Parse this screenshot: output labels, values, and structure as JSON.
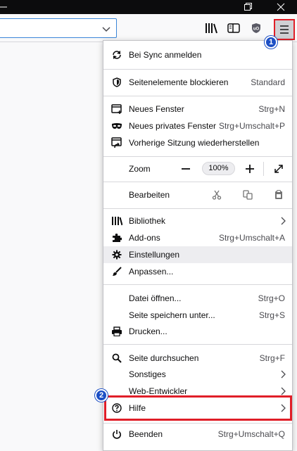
{
  "menu": {
    "sync": "Bei Sync anmelden",
    "blocking": {
      "label": "Seitenelemente blockieren",
      "value": "Standard"
    },
    "new_window": {
      "label": "Neues Fenster",
      "shortcut": "Strg+N"
    },
    "private_window": {
      "label": "Neues privates Fenster",
      "shortcut": "Strg+Umschalt+P"
    },
    "restore_session": "Vorherige Sitzung wiederherstellen",
    "zoom": {
      "label": "Zoom",
      "level": "100%"
    },
    "edit": "Bearbeiten",
    "library": "Bibliothek",
    "addons": {
      "label": "Add-ons",
      "shortcut": "Strg+Umschalt+A"
    },
    "settings": "Einstellungen",
    "customize": "Anpassen...",
    "open_file": {
      "label": "Datei öffnen...",
      "shortcut": "Strg+O"
    },
    "save_page": {
      "label": "Seite speichern unter...",
      "shortcut": "Strg+S"
    },
    "print": "Drucken...",
    "find": {
      "label": "Seite durchsuchen",
      "shortcut": "Strg+F"
    },
    "more": "Sonstiges",
    "web_dev": "Web-Entwickler",
    "help": "Hilfe",
    "quit": {
      "label": "Beenden",
      "shortcut": "Strg+Umschalt+Q"
    }
  },
  "annotations": {
    "badge1": "1",
    "badge2": "2"
  },
  "icons": [
    "maximize-icon",
    "close-icon",
    "dropdown-icon",
    "library-icon",
    "sidebar-icon",
    "ublock-icon",
    "hamburger-icon",
    "sync-icon",
    "shield-icon",
    "new-window-icon",
    "private-mask-icon",
    "restore-icon",
    "cut-icon",
    "copy-icon",
    "paste-icon",
    "addons-icon",
    "gear-icon",
    "brush-icon",
    "printer-icon",
    "search-icon",
    "help-icon",
    "power-icon"
  ],
  "colors": {
    "highlight": "#e01e28",
    "badge": "#1c4fc5",
    "urlbar_focus": "#3a85d8"
  }
}
